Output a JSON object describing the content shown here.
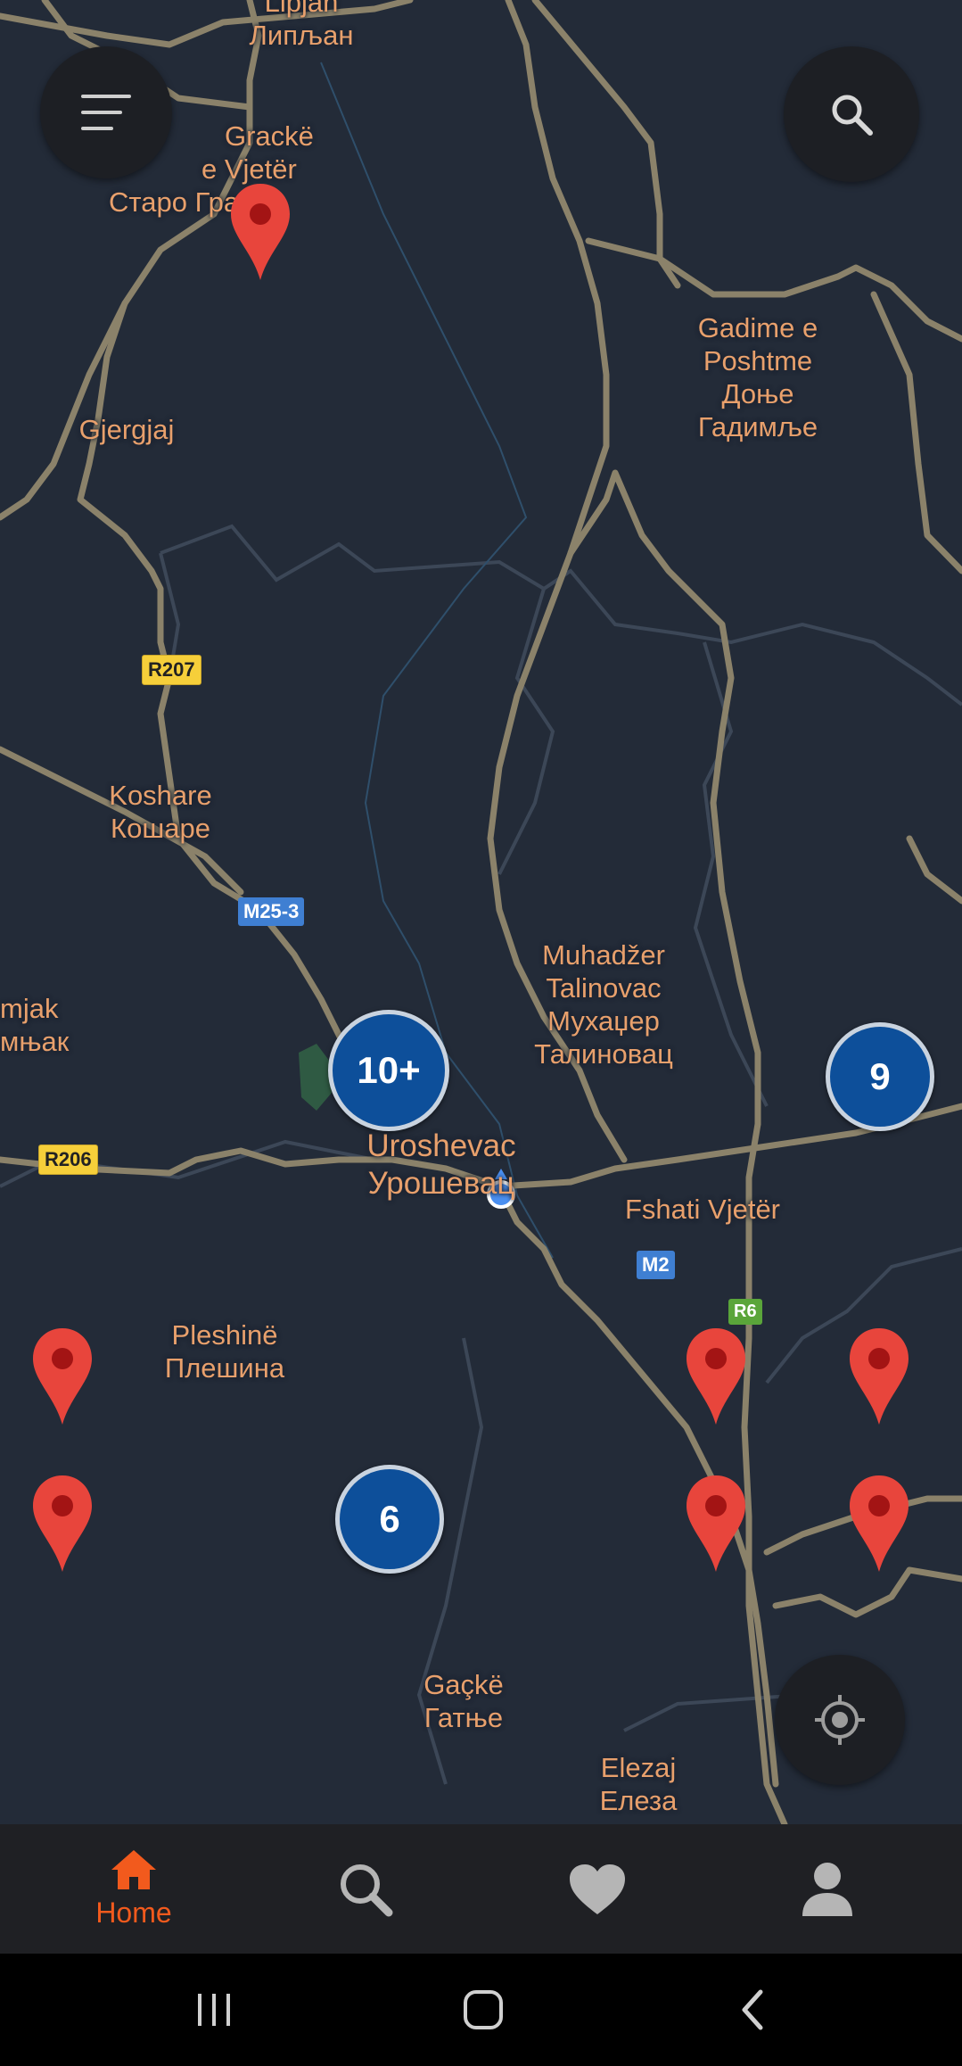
{
  "map": {
    "places": [
      {
        "id": "lipljan",
        "lines": [
          "Lipjan",
          "Липљан"
        ]
      },
      {
        "id": "grack",
        "lines": [
          "Grackë",
          "e Vjetër",
          "Старо Гра"
        ]
      },
      {
        "id": "gjergjaj",
        "lines": [
          "Gjergjaj"
        ]
      },
      {
        "id": "gadime",
        "lines": [
          "Gadime e",
          "Poshtme",
          "Доње",
          "Гадимље"
        ]
      },
      {
        "id": "koshare",
        "lines": [
          "Koshare",
          "Кошаре"
        ]
      },
      {
        "id": "muhadzer",
        "lines": [
          "Muhadžer",
          "Talinovac",
          "Мухаџер",
          "Талиновац"
        ]
      },
      {
        "id": "smjak",
        "lines": [
          "mjak",
          "мњак"
        ]
      },
      {
        "id": "uroshevac",
        "lines": [
          "Uroshevac",
          "Урошевац"
        ]
      },
      {
        "id": "fshati",
        "lines": [
          "Fshati Vjetër"
        ]
      },
      {
        "id": "pleshine",
        "lines": [
          "Pleshinë",
          "Плешина"
        ]
      },
      {
        "id": "gacke",
        "lines": [
          "Gaçkë",
          "Гатње"
        ]
      },
      {
        "id": "elezaj",
        "lines": [
          "Elezaj",
          "Елеза"
        ]
      }
    ],
    "shields": [
      {
        "id": "r207",
        "text": "R207",
        "style": "yellow"
      },
      {
        "id": "m25-3",
        "text": "M25-3",
        "style": "blue"
      },
      {
        "id": "r206",
        "text": "R206",
        "style": "yellow"
      },
      {
        "id": "m2",
        "text": "M2",
        "style": "blue"
      },
      {
        "id": "r6",
        "text": "R6",
        "style": "green"
      }
    ],
    "clusters": [
      {
        "id": "cluster-a",
        "count": "10+"
      },
      {
        "id": "cluster-b",
        "count": "9"
      },
      {
        "id": "cluster-c",
        "count": "6"
      }
    ],
    "marker_count": 7,
    "colors": {
      "marker": "#e8453c",
      "cluster": "#0d4f9a",
      "place_label": "#e8a06c",
      "road": "#8b826a"
    }
  },
  "controls": {
    "menu_icon": "menu-icon",
    "search_icon": "search-icon",
    "locate_icon": "my-location-icon"
  },
  "bottom_nav": {
    "items": [
      {
        "icon": "home-icon",
        "label": "Home",
        "active": true
      },
      {
        "icon": "search-icon",
        "label": "",
        "active": false
      },
      {
        "icon": "heart-icon",
        "label": "",
        "active": false
      },
      {
        "icon": "profile-icon",
        "label": "",
        "active": false
      }
    ],
    "active_color": "#f25a1d",
    "inactive_color": "#b5b5b5"
  },
  "system_nav": {
    "icons": [
      "recent-apps-icon",
      "home-button-icon",
      "back-icon"
    ]
  }
}
